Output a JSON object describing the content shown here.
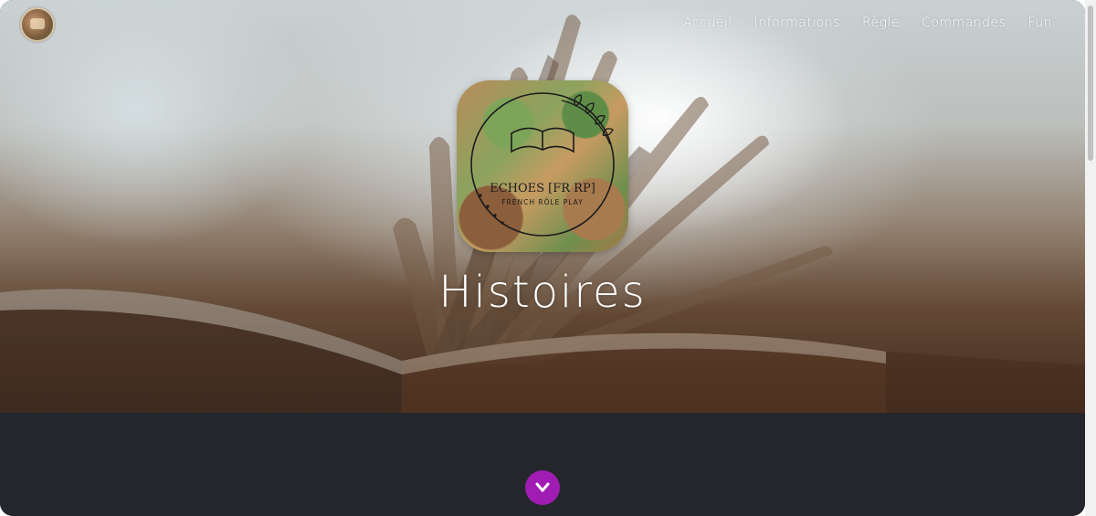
{
  "nav": {
    "items": [
      {
        "label": "Accueil"
      },
      {
        "label": "Informations"
      },
      {
        "label": "Règle"
      },
      {
        "label": "Commandes"
      },
      {
        "label": "Fun"
      }
    ]
  },
  "badge": {
    "name": "ECHOES [FR RP]",
    "tagline": "FRENCH RÔLE PLAY"
  },
  "hero": {
    "title": "Histoires"
  },
  "colors": {
    "accent": "#a01cb3",
    "lower_bg": "#24262c"
  },
  "icons": {
    "scroll_down": "chevron-down-icon",
    "logo": "server-logo-icon"
  }
}
